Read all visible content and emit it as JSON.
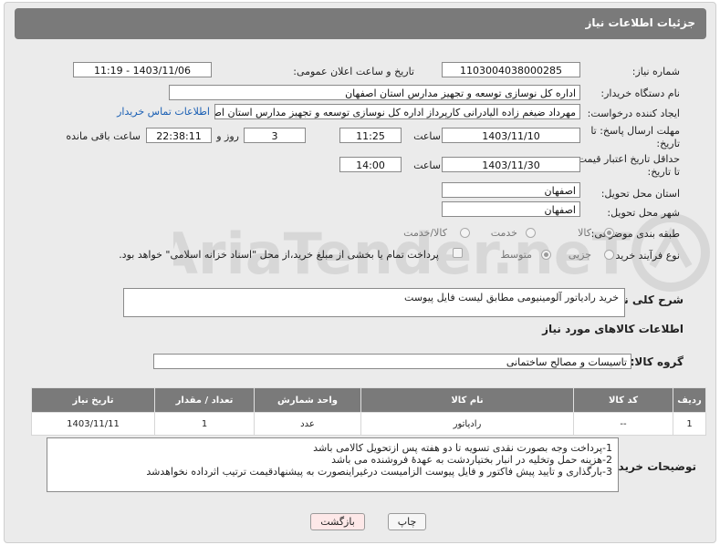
{
  "header": {
    "title": "جزئیات اطلاعات نیاز"
  },
  "fields": {
    "need_number_label": "شماره نیاز:",
    "need_number": "1103004038000285",
    "announce_label": "تاریخ و ساعت اعلان عمومی:",
    "announce_value": "1403/11/06 - 11:19",
    "buyer_org_label": "نام دستگاه خریدار:",
    "buyer_org": "اداره کل نوسازی  توسعه و تجهیز مدارس استان اصفهان",
    "creator_label": "ایجاد کننده درخواست:",
    "creator": "مهرداد ضیغم زاده الیادرانی کارپرداز اداره کل نوسازی  توسعه و تجهیز مدارس استان اصفهان",
    "contact_link": "اطلاعات تماس خریدار",
    "deadline_label": "مهلت ارسال پاسخ: تا تاریخ:",
    "deadline_date": "1403/11/10",
    "time_label": "ساعت",
    "deadline_time": "11:25",
    "days_value": "3",
    "days_label": "روز و",
    "remaining_value": "22:38:11",
    "remaining_label": "ساعت باقی مانده",
    "validity_label": "حداقل تاریخ اعتبار قیمت: تا تاریخ:",
    "validity_date": "1403/11/30",
    "validity_time": "14:00",
    "province_label": "استان محل تحویل:",
    "province": "اصفهان",
    "city_label": "شهر محل تحویل:",
    "city": "اصفهان",
    "category_label": "طبقه بندی موضوعی:",
    "category_options": [
      "کالا",
      "خدمت",
      "کالا/خدمت"
    ],
    "process_label": "نوع فرآیند خرید :",
    "process_options": [
      "جزیی",
      "متوسط"
    ],
    "payment_note": "پرداخت تمام یا بخشی از مبلغ خرید،از محل \"اسناد خزانه اسلامی\" خواهد بود."
  },
  "description": {
    "label": "شرح کلی نیاز:",
    "value": "خرید رادیاتور آلومینیومی مطابق لیست فایل پیوست"
  },
  "goods": {
    "section_title": "اطلاعات کالاهای مورد نیاز",
    "group_label": "گروه کالا:",
    "group_value": "تاسیسات و مصالح ساختمانی",
    "columns": [
      "ردیف",
      "کد کالا",
      "نام کالا",
      "واحد شمارش",
      "تعداد / مقدار",
      "تاریخ نیاز"
    ],
    "rows": [
      {
        "row": "1",
        "code": "--",
        "name": "رادیاتور",
        "unit": "عدد",
        "qty": "1",
        "date": "1403/11/11"
      }
    ]
  },
  "buyer_notes": {
    "label": "توضیحات خریدار:",
    "lines": [
      "1-پرداخت وجه بصورت نقدی تسویه تا دو هفته پس ازتحویل کالامی باشد",
      "2-هزینه حمل وتخلیه در انبار بختیاردشت به عهدۀ فروشنده می باشد",
      "3-بارگذاری و تایید پیش فاکتور و فایل پیوست الزامیست درغیراینصورت به پیشنهادقیمت ترتیب اثرداده نخواهدشد"
    ]
  },
  "buttons": {
    "print": "چاپ",
    "back": "بازگشت"
  },
  "watermark": {
    "text": "AriaTender.neT"
  },
  "colors": {
    "header": "#7a7a7a",
    "link": "#1a5fb4",
    "back_button_bg": "#fde8e8"
  }
}
